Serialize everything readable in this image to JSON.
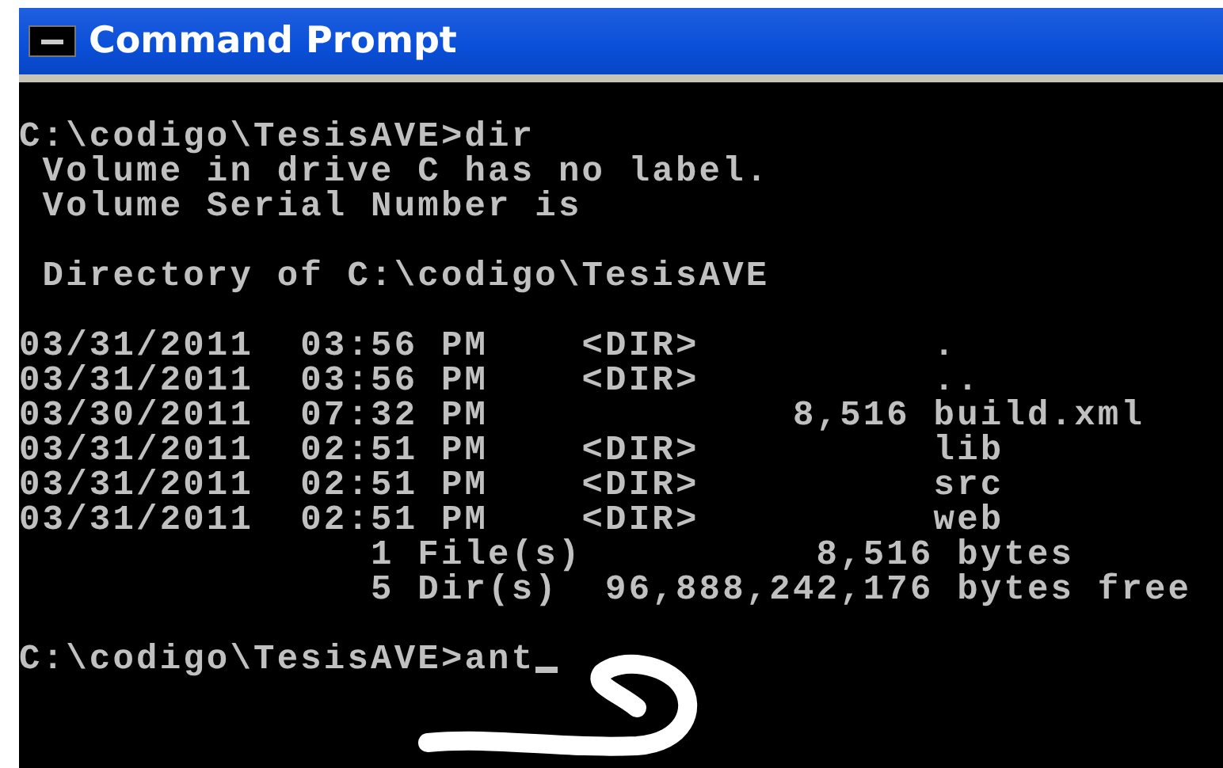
{
  "window": {
    "title": "Command Prompt"
  },
  "console": {
    "blocks": [
      [
        "C:\\codigo\\TesisAVE>dir",
        " Volume in drive C has no label.",
        " Volume Serial Number is"
      ],
      [
        " Directory of C:\\codigo\\TesisAVE"
      ],
      [
        "03/31/2011  03:56 PM    <DIR>          .",
        "03/31/2011  03:56 PM    <DIR>          ..",
        "03/30/2011  07:32 PM             8,516 build.xml",
        "03/31/2011  02:51 PM    <DIR>          lib",
        "03/31/2011  02:51 PM    <DIR>          src",
        "03/31/2011  02:51 PM    <DIR>          web",
        "               1 File(s)          8,516 bytes",
        "               5 Dir(s)  96,888,242,176 bytes free"
      ]
    ],
    "prompt": {
      "text": "C:\\codigo\\TesisAVE>ant",
      "cursor": true
    }
  }
}
